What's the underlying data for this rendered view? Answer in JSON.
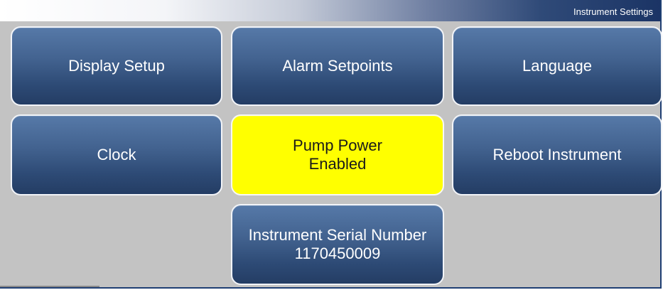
{
  "header": {
    "title": "Instrument Settings"
  },
  "buttons": {
    "display_setup": "Display Setup",
    "alarm_setpoints": "Alarm Setpoints",
    "language": "Language",
    "clock": "Clock",
    "pump_power": {
      "line1": "Pump Power",
      "line2": "Enabled"
    },
    "reboot_instrument": "Reboot Instrument",
    "serial_number": {
      "line1": "Instrument Serial Number",
      "line2": "1170450009"
    }
  },
  "colors": {
    "button_gradient_top": "#5679a8",
    "button_gradient_bottom": "#243d64",
    "active_button": "#ffff00",
    "background": "#c3c3c3",
    "title_bar_dark": "#1b3465"
  }
}
